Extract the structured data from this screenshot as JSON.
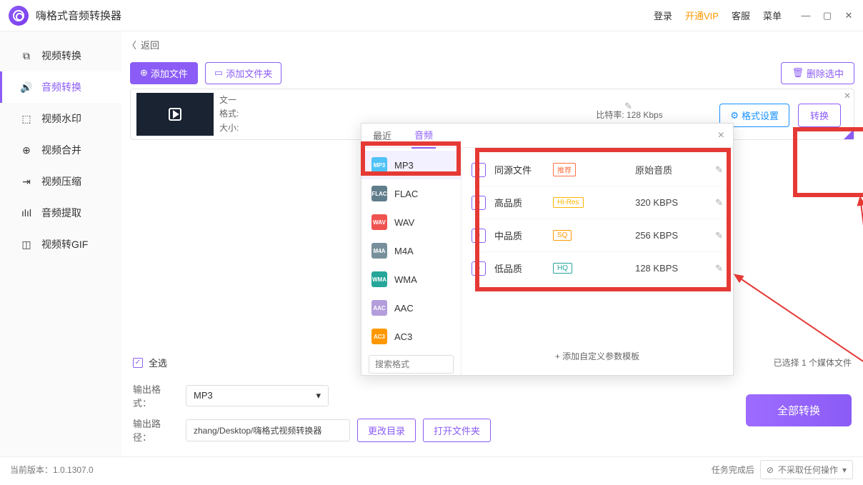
{
  "app": {
    "title": "嗨格式音频转换器"
  },
  "titlebar": {
    "login": "登录",
    "vip": "开通VIP",
    "service": "客服",
    "menu": "菜单"
  },
  "sidebar": {
    "items": [
      {
        "label": "视频转换"
      },
      {
        "label": "音频转换"
      },
      {
        "label": "视频水印"
      },
      {
        "label": "视频合并"
      },
      {
        "label": "视频压缩"
      },
      {
        "label": "音频提取"
      },
      {
        "label": "视频转GIF"
      }
    ]
  },
  "back": {
    "label": "返回"
  },
  "toolbar": {
    "add_file": "添加文件",
    "add_folder": "添加文件夹",
    "delete_selected": "删除选中"
  },
  "file": {
    "name_prefix": "文一",
    "format_prefix": "格式:",
    "size_prefix": "大小:",
    "bitrate": "比特率: 128 Kbps",
    "format_settings": "格式设置",
    "convert": "转换"
  },
  "popup": {
    "tabs": {
      "recent": "最近",
      "audio": "音频"
    },
    "search_placeholder": "搜索格式",
    "formats": [
      {
        "name": "MP3",
        "color": "#4fc3f7"
      },
      {
        "name": "FLAC",
        "color": "#607d8b"
      },
      {
        "name": "WAV",
        "color": "#ef5350"
      },
      {
        "name": "M4A",
        "color": "#78909c"
      },
      {
        "name": "WMA",
        "color": "#26a69a"
      },
      {
        "name": "AAC",
        "color": "#b39ddb"
      },
      {
        "name": "AC3",
        "color": "#ff9800"
      }
    ],
    "quality": [
      {
        "name": "同源文件",
        "badge": "推荐",
        "badge_color": "#ff7043",
        "rate": "原始音质"
      },
      {
        "name": "高品质",
        "badge": "Hi-Res",
        "badge_color": "#ffb300",
        "rate": "320 KBPS"
      },
      {
        "name": "中品质",
        "badge": "SQ",
        "badge_color": "#ff9800",
        "rate": "256 KBPS"
      },
      {
        "name": "低品质",
        "badge": "HQ",
        "badge_color": "#26a69a",
        "rate": "128 KBPS"
      }
    ],
    "add_template": "+ 添加自定义参数模板"
  },
  "bottom": {
    "select_all": "全选",
    "selected_count": "已选择 1 个媒体文件",
    "out_format_label": "输出格式：",
    "out_format_value": "MP3",
    "out_path_label": "输出路径：",
    "out_path_value": "zhang/Desktop/嗨格式视频转换器",
    "change_dir": "更改目录",
    "open_folder": "打开文件夹",
    "convert_all": "全部转换"
  },
  "status": {
    "version_label": "当前版本：",
    "version": "1.0.1307.0",
    "after_label": "任务完成后",
    "after_action": "不采取任何操作"
  }
}
